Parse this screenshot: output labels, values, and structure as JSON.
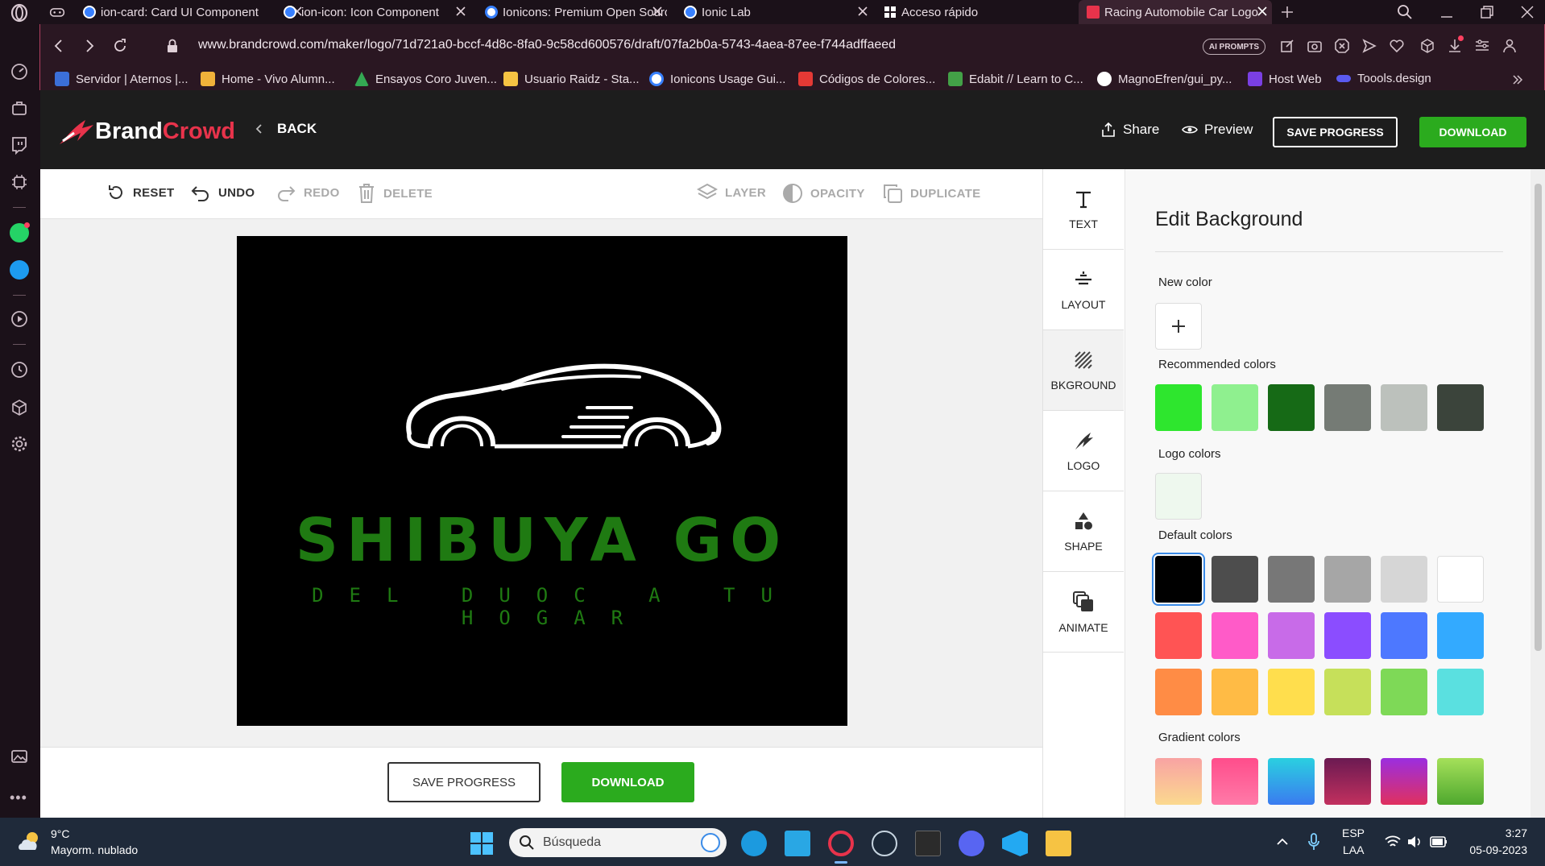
{
  "browser": {
    "tabs": [
      {
        "title": "ion-card: Card UI Component",
        "fav": "ionic-icon",
        "color": "#3880ff"
      },
      {
        "title": "ion-icon: Icon Component",
        "fav": "ionic-icon",
        "color": "#3880ff"
      },
      {
        "title": "Ionicons: Premium Open Source",
        "fav": "ionicons-icon",
        "color": "#3880ff"
      },
      {
        "title": "Ionic Lab",
        "fav": "ionic-icon",
        "color": "#3880ff"
      },
      {
        "title": "Acceso rápido",
        "fav": "grid-icon",
        "color": "#ffffff"
      },
      {
        "title": "Racing Automobile Car Logo",
        "fav": "brandcrowd-icon",
        "color": "#e8334b"
      }
    ],
    "url": "www.brandcrowd.com/maker/logo/71d721a0-bccf-4d8c-8fa0-9c58cd600576/draft/07fa2b0a-5743-4aea-87ee-f744adffaeed",
    "ai_prompts": "AI PROMPTS",
    "bookmarks": [
      {
        "label": "Servidor | Aternos |...",
        "color": "#3b6fd8"
      },
      {
        "label": "Home - Vivo Alumn...",
        "color": "#f0b23a"
      },
      {
        "label": "Ensayos Coro Juven...",
        "color": "#34a853"
      },
      {
        "label": "Usuario Raidz - Sta...",
        "color": "#f6c343"
      },
      {
        "label": "Ionicons Usage Gui...",
        "color": "#3880ff"
      },
      {
        "label": "Códigos de Colores...",
        "color": "#e53935"
      },
      {
        "label": "Edabit // Learn to C...",
        "color": "#43a047"
      },
      {
        "label": "MagnoEfren/gui_py...",
        "color": "#ffffff"
      },
      {
        "label": "Host Web",
        "color": "#7b3fe4"
      },
      {
        "label": "Toools.design",
        "color": "#5a5af0"
      }
    ]
  },
  "header": {
    "brand_part1": "Brand",
    "brand_part2": "Crowd",
    "back": "BACK",
    "share": "Share",
    "preview": "Preview",
    "save_progress": "SAVE PROGRESS",
    "download": "DOWNLOAD"
  },
  "toolbar": {
    "reset": "RESET",
    "undo": "UNDO",
    "redo": "REDO",
    "delete": "DELETE",
    "layer": "LAYER",
    "opacity": "OPACITY",
    "duplicate": "DUPLICATE"
  },
  "logo": {
    "title": "SHIBUYA GO",
    "tagline": "DEL DUOC A TU HOGAR",
    "text_color": "#1f7a12",
    "background": "#000000"
  },
  "bottom": {
    "save_progress": "SAVE PROGRESS",
    "download": "DOWNLOAD"
  },
  "side_menu": [
    {
      "label": "TEXT",
      "icon": "text-icon"
    },
    {
      "label": "LAYOUT",
      "icon": "layout-icon"
    },
    {
      "label": "BKGROUND",
      "icon": "background-icon"
    },
    {
      "label": "LOGO",
      "icon": "logo-icon"
    },
    {
      "label": "SHAPE",
      "icon": "shape-icon"
    },
    {
      "label": "ANIMATE",
      "icon": "animate-icon"
    }
  ],
  "panel": {
    "title": "Edit Background",
    "new_color": "New color",
    "recommended_colors_label": "Recommended colors",
    "recommended": [
      "#2ee62e",
      "#8ff08f",
      "#166a16",
      "#757b75",
      "#bcc1bc",
      "#3b443b"
    ],
    "logo_colors_label": "Logo colors",
    "logo_colors": [
      "#eef8ee"
    ],
    "default_colors_label": "Default colors",
    "default": [
      "#000000",
      "#4d4d4d",
      "#777777",
      "#a6a6a6",
      "#d6d6d6",
      "#ffffff",
      "#ff5454",
      "#ff5bc8",
      "#c86be8",
      "#8b4dff",
      "#4d78ff",
      "#33aaff",
      "#ff8c45",
      "#ffbb45",
      "#ffde4d",
      "#c6e05a",
      "#7ed957",
      "#5ae0e0"
    ],
    "gradient_colors_label": "Gradient colors",
    "gradients": [
      [
        "#f8a3a3",
        "#fbd98f"
      ],
      [
        "#ff4d8b",
        "#ff7aa8"
      ],
      [
        "#2ad0e0",
        "#3a7bf0"
      ],
      [
        "#6b1a52",
        "#c2305e"
      ],
      [
        "#9b2ee0",
        "#e0305e"
      ],
      [
        "#a5e05a",
        "#4ea82e"
      ]
    ]
  },
  "taskbar": {
    "temp": "9°C",
    "weather": "Mayorm. nublado",
    "search": "Búsqueda",
    "lang1": "ESP",
    "lang2": "LAA",
    "time": "3:27",
    "date": "05-09-2023"
  }
}
